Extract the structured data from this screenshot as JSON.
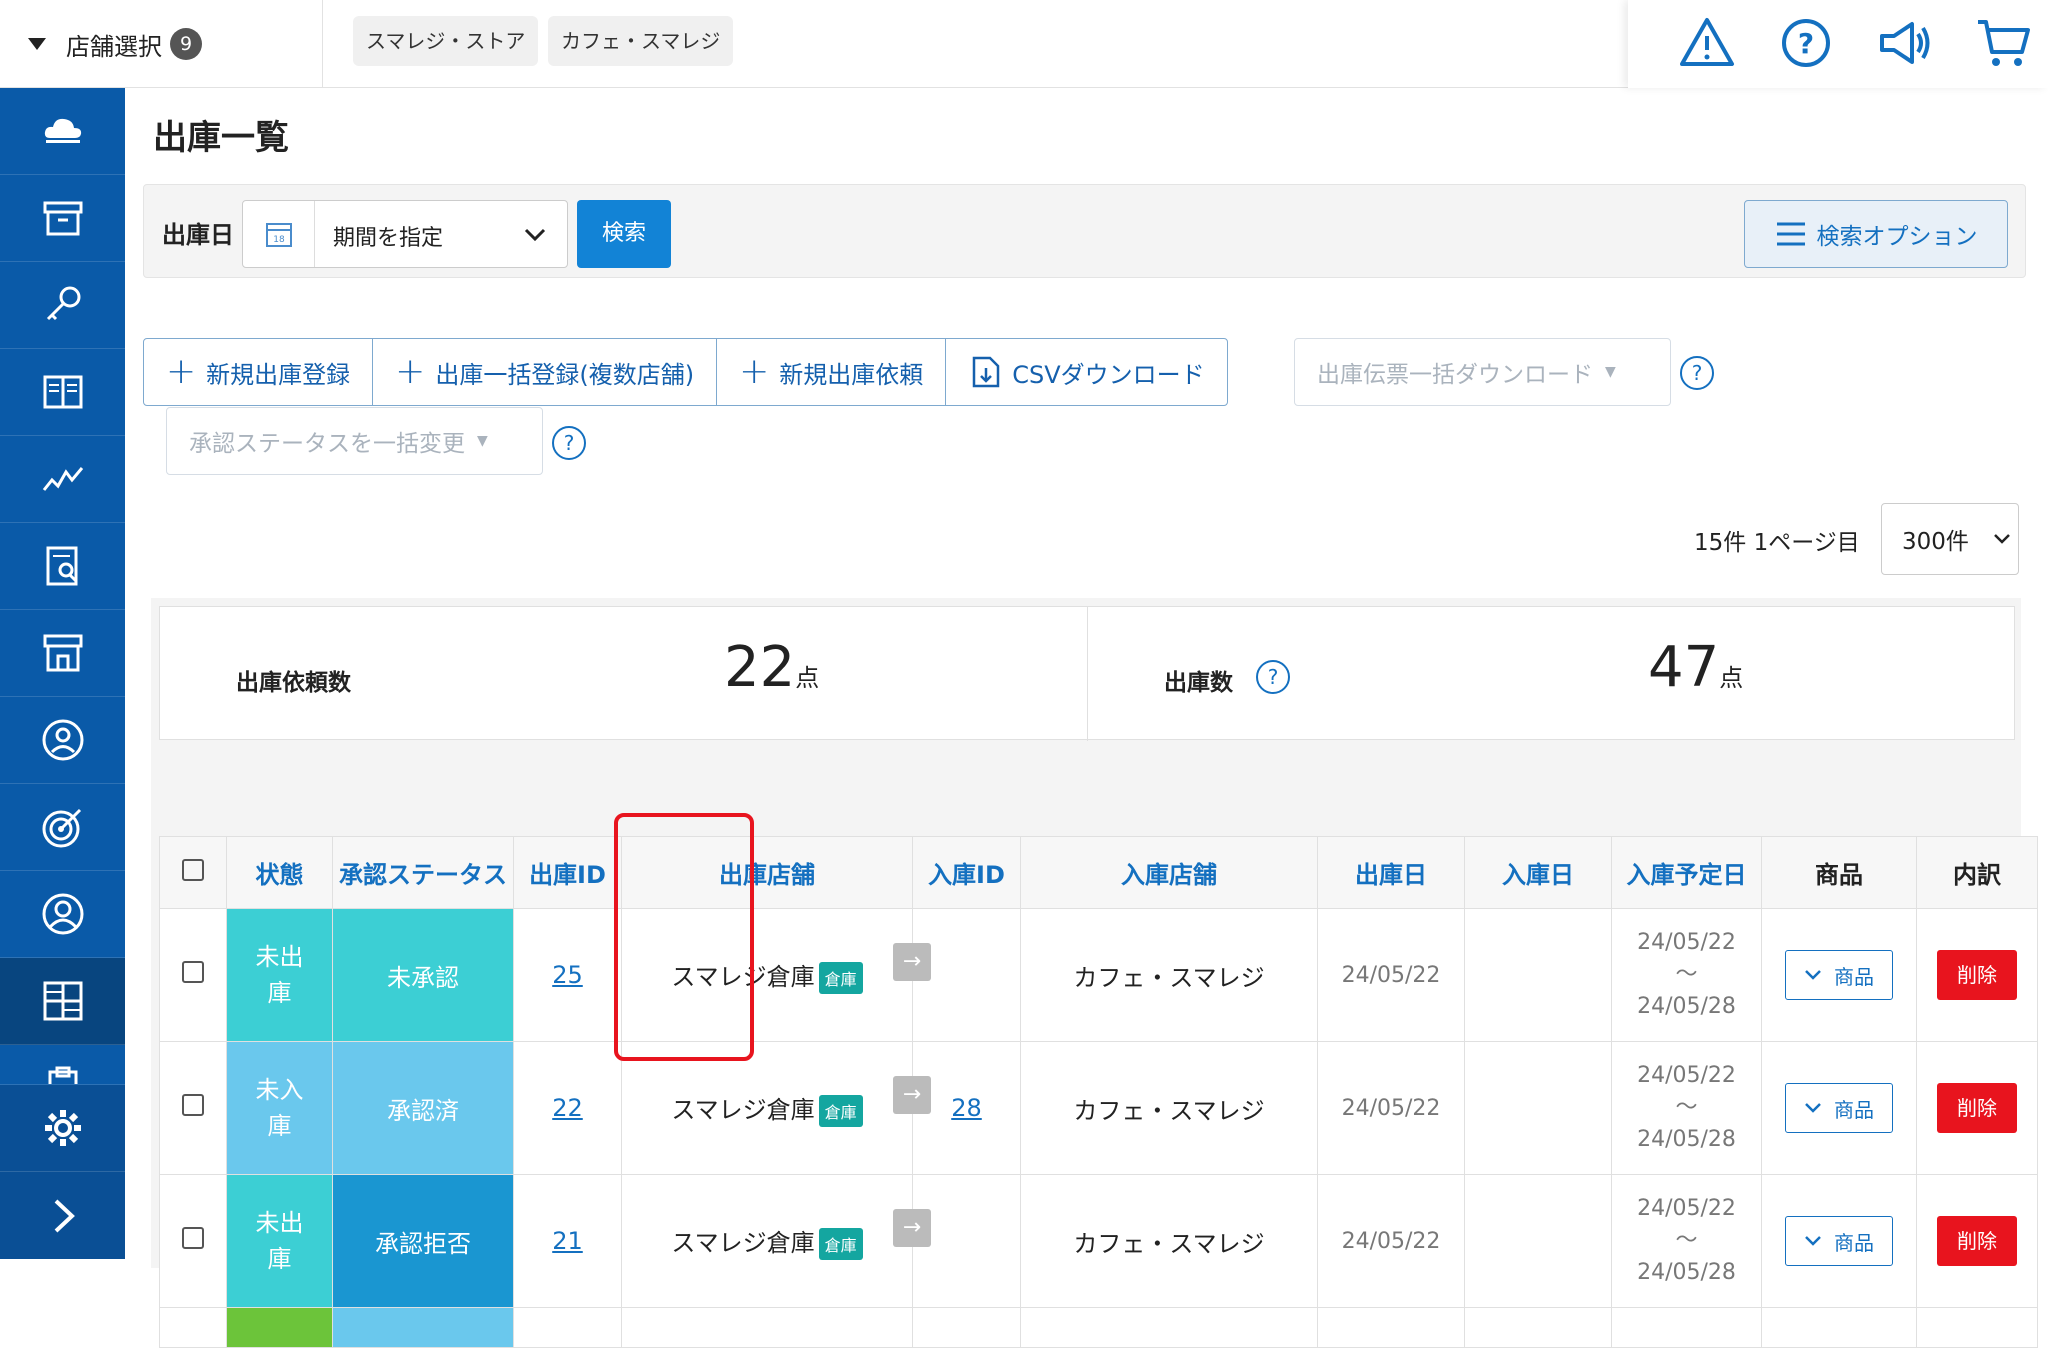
{
  "header": {
    "store_select_label": "店舗選択",
    "store_count": "9",
    "stores": [
      "スマレジ・ストア",
      "カフェ・スマレジ"
    ],
    "icons": [
      "warning-icon",
      "help-icon",
      "megaphone-icon",
      "cart-icon"
    ]
  },
  "page": {
    "title": "出庫一覧"
  },
  "search": {
    "date_label": "出庫日",
    "date_value": "期間を指定",
    "search_button": "検索",
    "options_button": "検索オプション"
  },
  "actions": {
    "new_shipment": "新規出庫登録",
    "bulk_shipment": "出庫一括登録(複数店舗)",
    "new_request": "新規出庫依頼",
    "csv_download": "CSVダウンロード",
    "slip_bulk_download": "出庫伝票一括ダウンロード",
    "approval_bulk_change": "承認ステータスを一括変更"
  },
  "paging": {
    "summary": "15件 1ページ目",
    "per_page": "300件"
  },
  "summary": {
    "request_label": "出庫依頼数",
    "request_value": "22",
    "request_unit": "点",
    "shipment_label": "出庫数",
    "shipment_value": "47",
    "shipment_unit": "点"
  },
  "table": {
    "headers": {
      "status": "状態",
      "approval": "承認ステータス",
      "ship_id": "出庫ID",
      "ship_store": "出庫店舗",
      "receive_id": "入庫ID",
      "receive_store": "入庫店舗",
      "ship_date": "出庫日",
      "receive_date": "入庫日",
      "planned_date": "入庫予定日",
      "product": "商品",
      "detail": "内訳"
    },
    "rows": [
      {
        "status": "未出庫",
        "approval": "未承認",
        "ship_id": "25",
        "ship_store": "スマレジ倉庫",
        "store_tag": "倉庫",
        "receive_id": "",
        "receive_store": "カフェ・スマレジ",
        "ship_date": "24/05/22",
        "receive_date": "",
        "planned_from": "24/05/22",
        "planned_tilde": "〜",
        "planned_to": "24/05/28",
        "product_btn": "商品",
        "delete_btn": "削除"
      },
      {
        "status": "未入庫",
        "approval": "承認済",
        "ship_id": "22",
        "ship_store": "スマレジ倉庫",
        "store_tag": "倉庫",
        "receive_id": "28",
        "receive_store": "カフェ・スマレジ",
        "ship_date": "24/05/22",
        "receive_date": "",
        "planned_from": "24/05/22",
        "planned_tilde": "〜",
        "planned_to": "24/05/28",
        "product_btn": "商品",
        "delete_btn": "削除"
      },
      {
        "status": "未出庫",
        "approval": "承認拒否",
        "ship_id": "21",
        "ship_store": "スマレジ倉庫",
        "store_tag": "倉庫",
        "receive_id": "",
        "receive_store": "カフェ・スマレジ",
        "ship_date": "24/05/22",
        "receive_date": "",
        "planned_from": "24/05/22",
        "planned_tilde": "〜",
        "planned_to": "24/05/28",
        "product_btn": "商品",
        "delete_btn": "削除"
      }
    ]
  },
  "colors": {
    "sidebar": "#0a5aa8",
    "primary": "#1283d6",
    "delete": "#e8141e",
    "status_unshipped": "#3ccfd4",
    "status_unreceived": "#6ac8ed",
    "approval_rejected": "#1a96d1"
  }
}
